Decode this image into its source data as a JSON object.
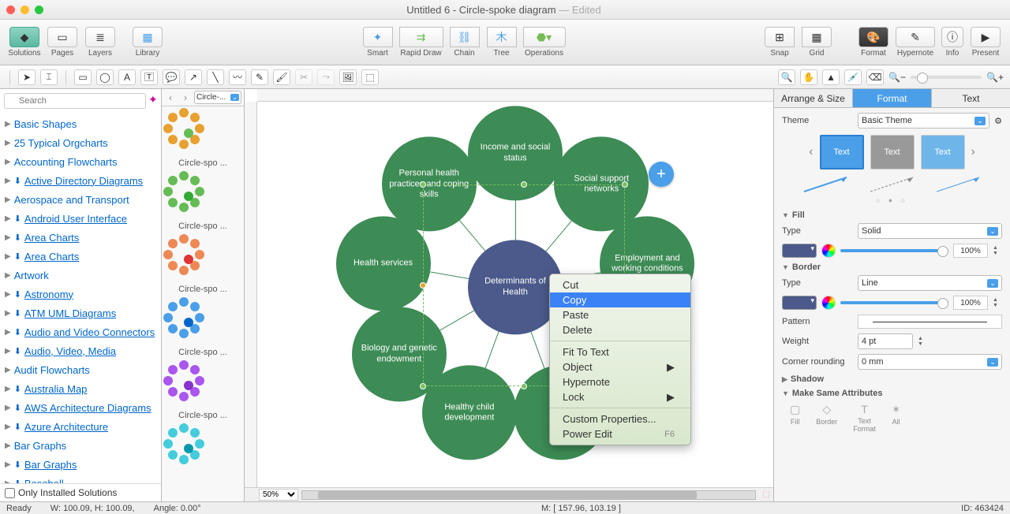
{
  "title": {
    "doc": "Untitled 6 - Circle-spoke diagram",
    "suffix": " — Edited"
  },
  "toolbar": {
    "solutions": "Solutions",
    "pages": "Pages",
    "layers": "Layers",
    "library": "Library",
    "smart": "Smart",
    "rapid": "Rapid Draw",
    "chain": "Chain",
    "tree": "Tree",
    "operations": "Operations",
    "snap": "Snap",
    "grid": "Grid",
    "format": "Format",
    "hypernote": "Hypernote",
    "info": "Info",
    "present": "Present"
  },
  "search": {
    "placeholder": "Search"
  },
  "solutions": [
    {
      "label": "Basic Shapes",
      "dl": false
    },
    {
      "label": "25 Typical Orgcharts",
      "dl": false
    },
    {
      "label": "Accounting Flowcharts",
      "dl": false
    },
    {
      "label": "Active Directory Diagrams",
      "dl": true
    },
    {
      "label": "Aerospace and Transport",
      "dl": false
    },
    {
      "label": "Android User Interface",
      "dl": true
    },
    {
      "label": "Area Charts",
      "dl": true
    },
    {
      "label": "Area Charts",
      "dl": true
    },
    {
      "label": "Artwork",
      "dl": false
    },
    {
      "label": "Astronomy",
      "dl": true
    },
    {
      "label": "ATM UML Diagrams",
      "dl": true
    },
    {
      "label": "Audio and Video Connectors",
      "dl": true
    },
    {
      "label": "Audio, Video, Media",
      "dl": true
    },
    {
      "label": "Audit Flowcharts",
      "dl": false
    },
    {
      "label": "Australia Map",
      "dl": true
    },
    {
      "label": "AWS Architecture Diagrams",
      "dl": true
    },
    {
      "label": "Azure Architecture",
      "dl": true
    },
    {
      "label": "Bar Graphs",
      "dl": false
    },
    {
      "label": "Bar Graphs",
      "dl": true
    },
    {
      "label": "Baseball",
      "dl": true
    }
  ],
  "only_installed": "Only Installed Solutions",
  "shapes": {
    "dropdown": "Circle-...",
    "items": [
      "Circle-spo ...",
      "Circle-spo ...",
      "Circle-spo ...",
      "Circle-spo ...",
      "Circle-spo ...",
      ""
    ]
  },
  "diagram": {
    "center": "Determinants of Health",
    "nodes": [
      "Income and social status",
      "Social support networks",
      "Employment and working conditions",
      "",
      "",
      "Healthy child development",
      "Biology and genetic endowment",
      "Health services",
      "Personal health practices and coping skills"
    ]
  },
  "context_menu": {
    "cut": "Cut",
    "copy": "Copy",
    "paste": "Paste",
    "delete": "Delete",
    "fit": "Fit To Text",
    "object": "Object",
    "hypernote": "Hypernote",
    "lock": "Lock",
    "custom": "Custom Properties...",
    "power": "Power Edit",
    "power_key": "F6"
  },
  "zoom_pct": "50%",
  "right": {
    "tabs": {
      "arrange": "Arrange & Size",
      "format": "Format",
      "text": "Text"
    },
    "theme_lbl": "Theme",
    "theme_val": "Basic Theme",
    "swatch": "Text",
    "fill": "Fill",
    "type_lbl": "Type",
    "fill_type": "Solid",
    "pct": "100%",
    "border": "Border",
    "border_type": "Line",
    "pattern": "Pattern",
    "weight": "Weight",
    "weight_val": "4 pt",
    "corner": "Corner rounding",
    "corner_val": "0 mm",
    "shadow": "Shadow",
    "same": "Make Same Attributes",
    "btm": {
      "fill": "Fill",
      "border": "Border",
      "textfmt": "Text\nFormat",
      "all": "All"
    }
  },
  "status": {
    "ready": "Ready",
    "wh": "W: 100.09,  H: 100.09,",
    "angle": "Angle: 0.00°",
    "mouse": "M: [ 157.96, 103.19 ]",
    "id": "ID: 463424"
  }
}
